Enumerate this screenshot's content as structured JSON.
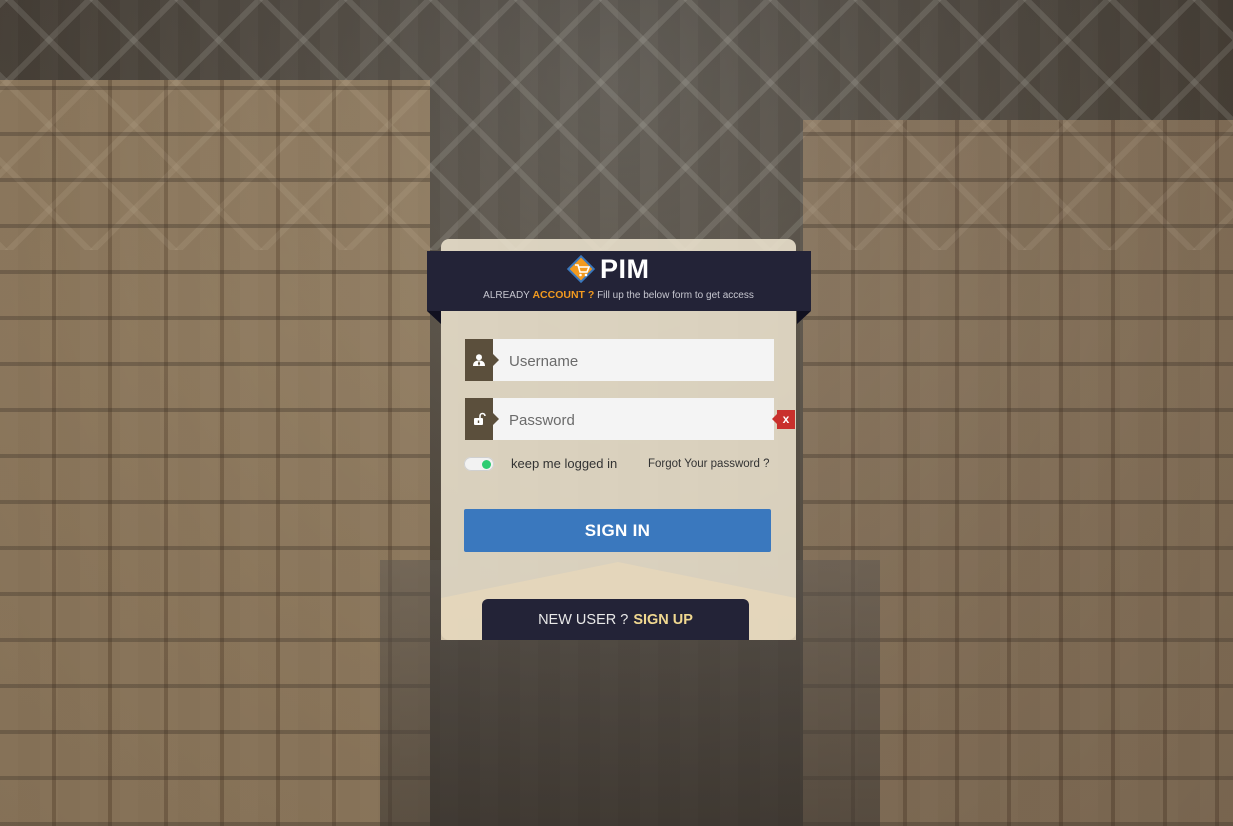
{
  "brand": {
    "name": "PIM",
    "logo_icon": "cart-diamond-icon",
    "colors": {
      "header": "#232337",
      "accent": "#f29a1f",
      "primary_button": "#3a78be",
      "error": "#c9302c"
    }
  },
  "header": {
    "already": "ALREADY",
    "account": "ACCOUNT ?",
    "hint": "Fill up the below form to get access"
  },
  "form": {
    "username": {
      "placeholder": "Username",
      "value": "",
      "icon": "user-icon"
    },
    "password": {
      "placeholder": "Password",
      "value": "",
      "icon": "unlock-icon",
      "error_badge": "x"
    },
    "keep_logged_in": {
      "label": "keep me logged in",
      "checked": true
    },
    "forgot_password": "Forgot Your password ?",
    "submit_label": "SIGN IN"
  },
  "footer": {
    "new_user": "NEW USER ?",
    "sign_up": "SIGN UP"
  }
}
